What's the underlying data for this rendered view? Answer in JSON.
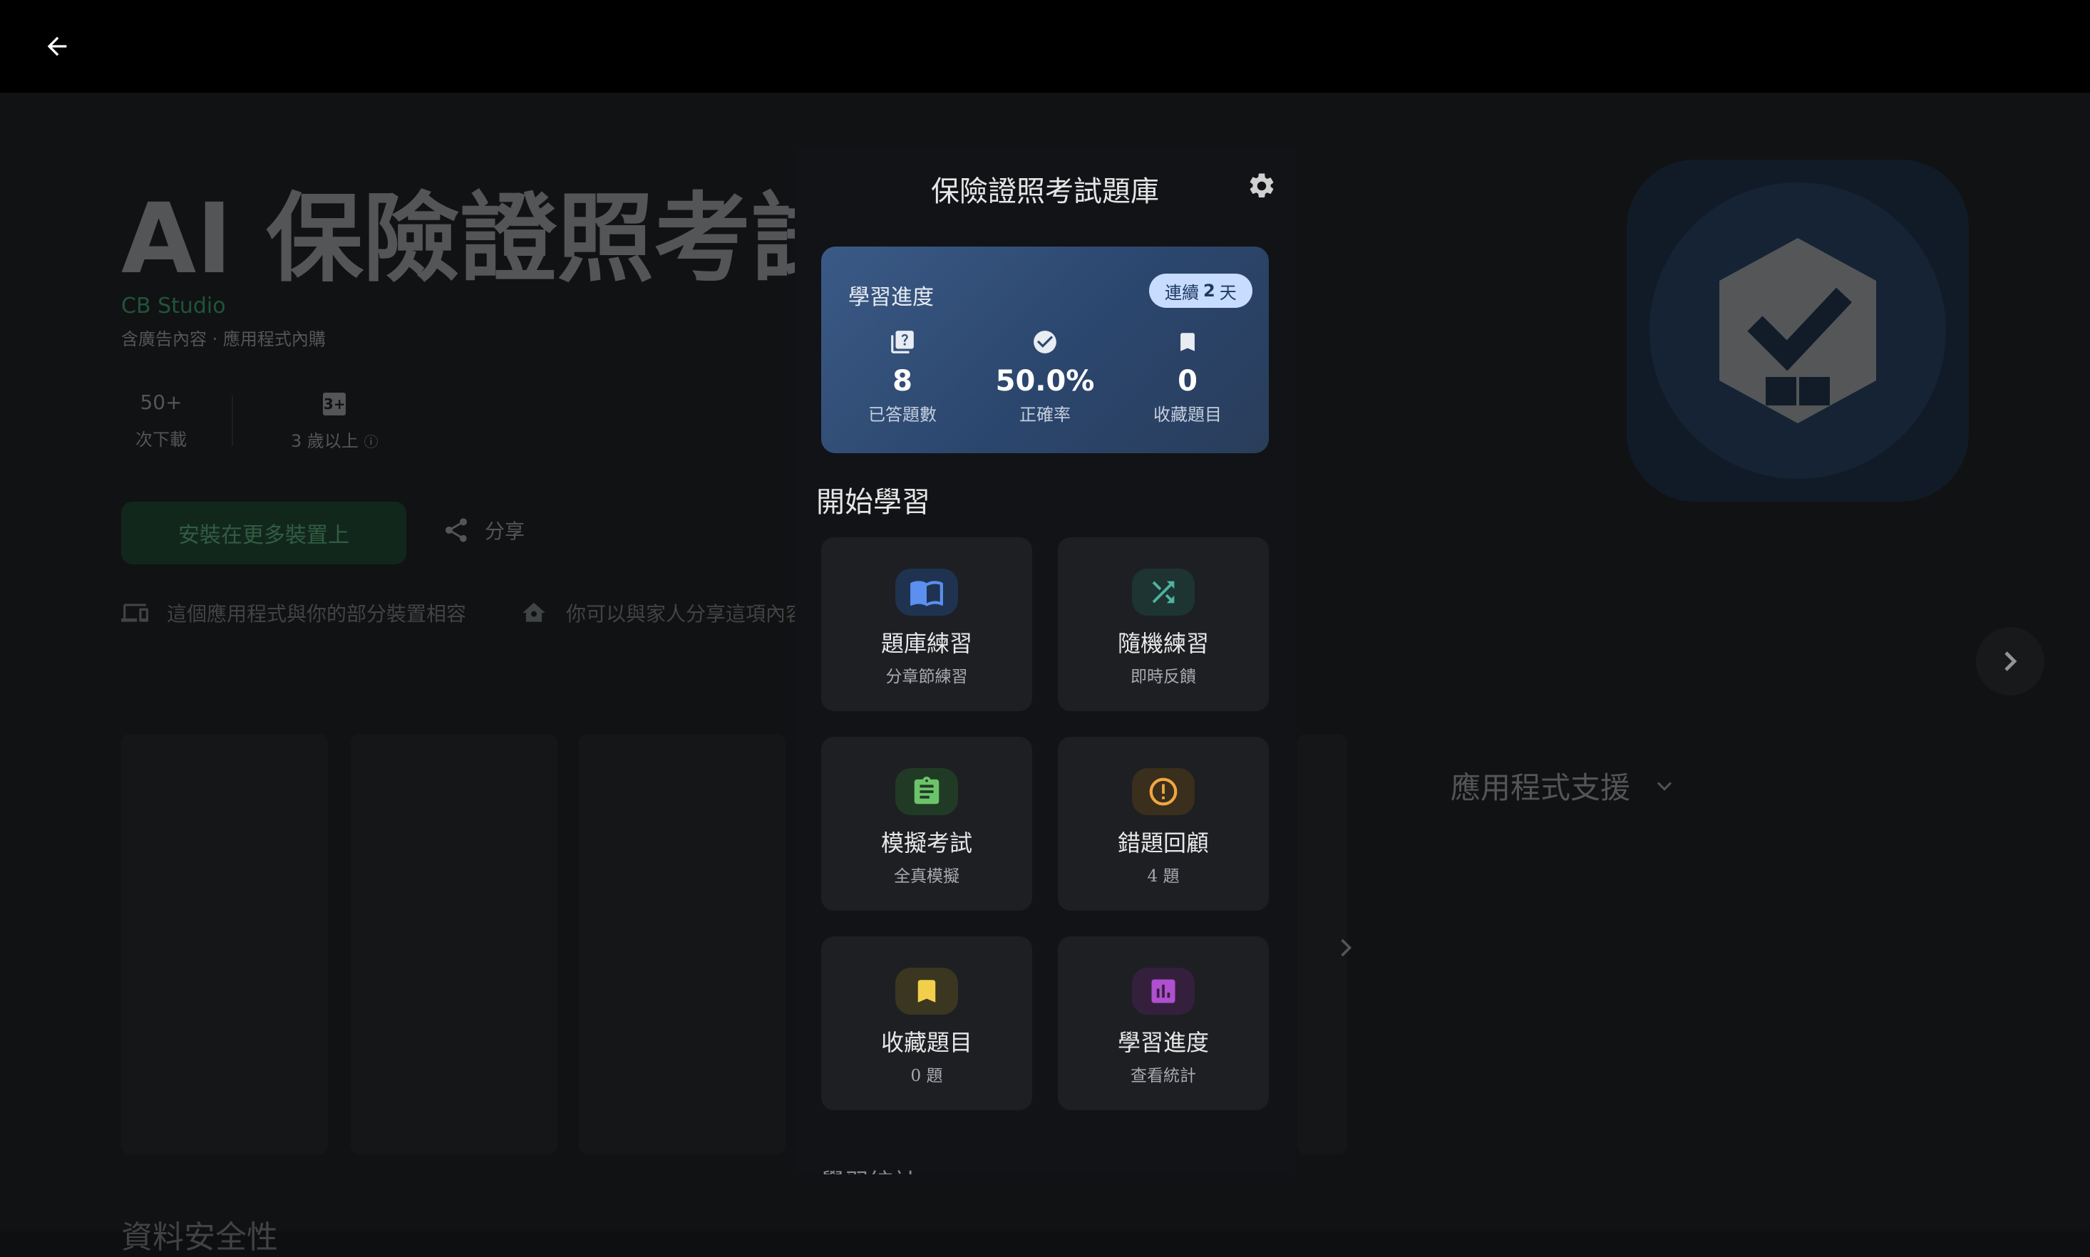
{
  "background": {
    "app_title": "AI 保險證照考試是",
    "developer": "CB Studio",
    "meta": "含廣告內容 · 應用程式內購",
    "stats": [
      {
        "value": "50+",
        "label": "次下載"
      },
      {
        "value": "3+",
        "label": "3 歲以上"
      }
    ],
    "install_label": "安裝在更多裝置上",
    "share_label": "分享",
    "compat_text": "這個應用程式與你的部分裝置相容",
    "family_text": "你可以與家人分享這項內容",
    "support_label": "應用程式支援",
    "bottom_text": "資料安全性"
  },
  "phone": {
    "title": "保險證照考試題庫",
    "progress": {
      "title": "學習進度",
      "streak_prefix": "連續",
      "streak_count": "2",
      "streak_suffix": "天",
      "stats": [
        {
          "value": "8",
          "label": "已答題數",
          "icon": "quiz-icon"
        },
        {
          "value": "50.0%",
          "label": "正確率",
          "icon": "check-circle-icon"
        },
        {
          "value": "0",
          "label": "收藏題目",
          "icon": "bookmark-icon"
        }
      ]
    },
    "section_title": "開始學習",
    "tiles": [
      {
        "title": "題庫練習",
        "sub": "分章節練習",
        "icon": "book-icon",
        "color": "#5b8ff0",
        "bg": "#1f3350"
      },
      {
        "title": "隨機練習",
        "sub": "即時反饋",
        "icon": "shuffle-icon",
        "color": "#4fb3a0",
        "bg": "#1d3433"
      },
      {
        "title": "模擬考試",
        "sub": "全真模擬",
        "icon": "clipboard-icon",
        "color": "#6cc46a",
        "bg": "#213a25"
      },
      {
        "title": "錯題回顧",
        "sub": "4 題",
        "icon": "alert-icon",
        "color": "#f0a640",
        "bg": "#3a2e1c"
      },
      {
        "title": "收藏題目",
        "sub": "0 題",
        "icon": "bookmark-icon",
        "color": "#f2cf4a",
        "bg": "#3a3620"
      },
      {
        "title": "學習進度",
        "sub": "查看統計",
        "icon": "chart-icon",
        "color": "#b04fcf",
        "bg": "#34203d"
      }
    ],
    "bottom_peek": "學習統計"
  }
}
